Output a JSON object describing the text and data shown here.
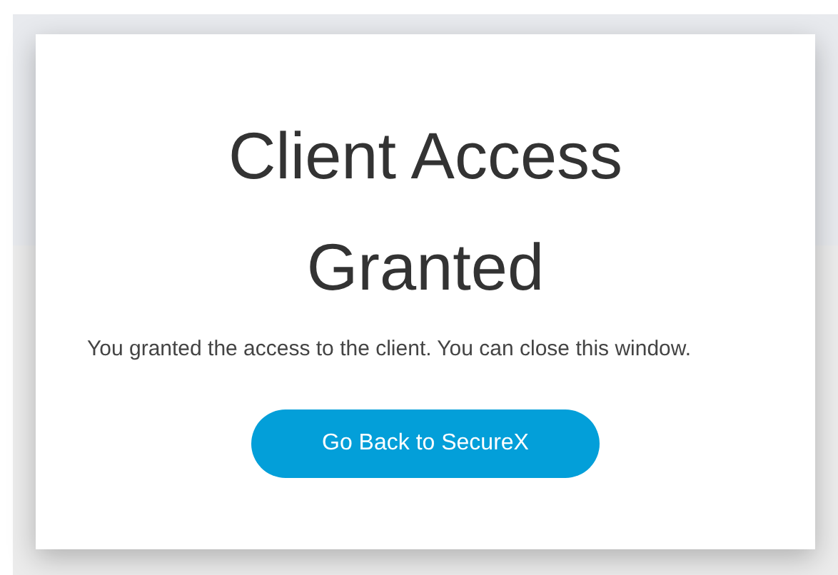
{
  "dialog": {
    "title": "Client Access Granted",
    "message": "You granted the access to the client. You can close this window.",
    "button": "Go Back to SecureX"
  }
}
